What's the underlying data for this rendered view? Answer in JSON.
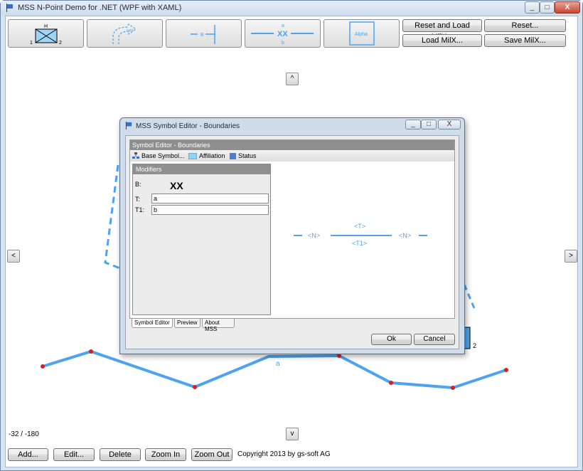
{
  "window": {
    "title": "MSS N-Point Demo for .NET (WPF with XAML)",
    "min_glyph": "_",
    "max_glyph": "□",
    "close_glyph": "X"
  },
  "toolbar": {
    "symbol1": {
      "top": "H",
      "left": "1",
      "right": "2"
    },
    "symbol2": {
      "text": "cats"
    },
    "symbol3": {
      "text": "B"
    },
    "symbol4": {
      "top": "a",
      "middle": "XX",
      "bottom": "b"
    },
    "symbol5": {
      "text": "Alpha"
    },
    "reset_load": "Reset and Load MilX...",
    "reset": "Reset...",
    "load": "Load MilX...",
    "save": "Save MilX..."
  },
  "nav": {
    "up": "^",
    "down": "v",
    "left": "<",
    "right": ">"
  },
  "status": {
    "coords": "-32 / -180"
  },
  "bottom": {
    "add": "Add...",
    "edit": "Edit...",
    "delete": "Delete",
    "zoom_in": "Zoom In",
    "zoom_out": "Zoom Out",
    "copyright": "Copyright 2013 by gs-soft AG"
  },
  "canvas": {
    "label_a": "a",
    "label_2": "2",
    "line_color": "#4da3f0",
    "point_color": "#d42020"
  },
  "dialog": {
    "title": "MSS Symbol Editor - Boundaries",
    "min_glyph": "_",
    "max_glyph": "□",
    "close_glyph": "X",
    "panel_title": "Symbol Editor - Boundaries",
    "tools": {
      "base": "Base Symbol...",
      "affiliation": "Affiliation",
      "status": "Status"
    },
    "modifiers": {
      "header": "Modifiers",
      "b_label": "B:",
      "b_value": "XX",
      "t_label": "T:",
      "t_value": "a",
      "t1_label": "T1:",
      "t1_value": "b"
    },
    "preview": {
      "n_left": "<N>",
      "t": "<T>",
      "t1": "<T1>",
      "n_right": "<N>"
    },
    "tabs": [
      "Symbol Editor",
      "Preview",
      "About MSS"
    ],
    "ok": "Ok",
    "cancel": "Cancel"
  }
}
